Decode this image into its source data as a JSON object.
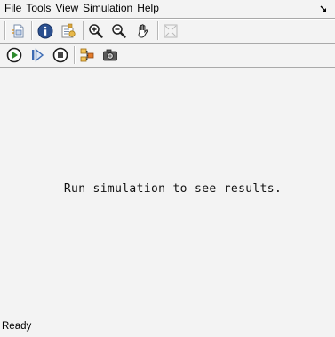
{
  "menu": {
    "items": [
      {
        "label": "File"
      },
      {
        "label": "Tools"
      },
      {
        "label": "View"
      },
      {
        "label": "Simulation"
      },
      {
        "label": "Help"
      }
    ]
  },
  "toolbar_top": {
    "buttons": [
      {
        "icon": "page-setup-icon"
      },
      {
        "icon": "info-icon"
      },
      {
        "icon": "properties-icon"
      },
      {
        "icon": "zoom-in-icon"
      },
      {
        "icon": "zoom-out-icon"
      },
      {
        "icon": "pan-hand-icon"
      },
      {
        "icon": "fit-to-view-icon"
      }
    ]
  },
  "toolbar_sim": {
    "buttons": [
      {
        "icon": "run-icon"
      },
      {
        "icon": "step-icon"
      },
      {
        "icon": "stop-icon"
      },
      {
        "icon": "block-diagram-icon"
      },
      {
        "icon": "snapshot-camera-icon"
      }
    ]
  },
  "canvas": {
    "message": "Run simulation to see results."
  },
  "status": {
    "text": "Ready"
  },
  "colors": {
    "background": "#f3f3f3",
    "run_green": "#2e8b2e",
    "info_blue": "#2a4f8f",
    "separator": "#a9a9a9"
  }
}
